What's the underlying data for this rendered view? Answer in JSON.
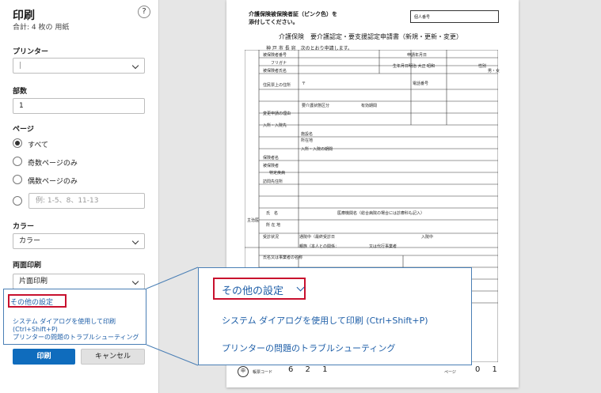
{
  "dialog": {
    "title": "印刷",
    "subtitle": "合計: 4 枚の 用紙",
    "help_icon": "?"
  },
  "printer": {
    "label": "プリンター",
    "value": "|"
  },
  "copies": {
    "label": "部数",
    "value": "1"
  },
  "pages": {
    "label": "ページ",
    "options": [
      "すべて",
      "奇数ページのみ",
      "偶数ページのみ"
    ],
    "selected_index": 0,
    "custom_placeholder": "例: 1-5、8、11-13"
  },
  "color": {
    "label": "カラー",
    "value": "カラー"
  },
  "duplex": {
    "label": "両面印刷",
    "value": "片面印刷"
  },
  "more_settings": "その他の設定",
  "links": {
    "system_dialog": "システム ダイアログを使用して印刷 (Ctrl+Shift+P)",
    "troubleshoot": "プリンターの問題のトラブルシューティング"
  },
  "buttons": {
    "print": "印刷",
    "cancel": "キャンセル"
  },
  "document": {
    "header_line1": "介護保険被保険者証（ピンク色）を",
    "header_line2": "添付してください。",
    "receipt_label": "個人番号",
    "form_title": "介護保険　要介護認定・要支援認定申請書（新規・更新・変更）",
    "addressee": "神 戸 市 長 宛　次のとおり申請します。",
    "row_insured_no": "被保険者番号",
    "row_furigana": "フリガナ",
    "row_name": "被保険者氏名",
    "row_birth": "生年月日",
    "row_era": "明治 大正 昭和",
    "row_sex": "性別",
    "row_sex_values": "男・女",
    "row_address": "住民票上の住所",
    "row_postal": "〒",
    "row_phone": "電話番号",
    "row_date_label": "申請年月日",
    "row_level": "要介護状態区分",
    "row_valid": "有効期間",
    "row_change": "変更申請の理由",
    "row_admission": "入所・入院先",
    "row_facility": "施設名",
    "row_location": "所在地",
    "row_period": "入所・入院の期間",
    "row_insurer": "保険者名",
    "row_insured": "被保険者",
    "row_disease": "特定疾病",
    "row_visit": "訪問先住所",
    "row_doctor": "主治医",
    "row_name_short": "氏　名",
    "row_medical": "医療機関名（総合病院の場合には診療科も記入）",
    "row_clinic_addr": "所 在 地",
    "row_consult": "受診状況",
    "row_consult_value": "通院中（最終受診日",
    "row_admitted": "入院中",
    "row_agent": "氏名又は事業者の名称",
    "row_relation": "親族（本人との関係：",
    "row_proxy": "又は代行事業者",
    "stamp": "申",
    "code_label": "帳票コード",
    "code_value": "6 2 1",
    "page_label": "ページ",
    "page_value": "0 1"
  },
  "colors": {
    "accent": "#0f6cbd",
    "highlight": "#c8102e",
    "link": "#1f5fa8"
  }
}
